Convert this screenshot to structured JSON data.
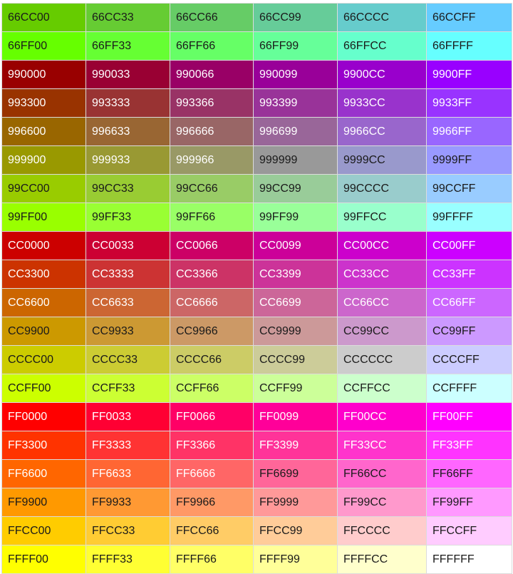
{
  "palette": {
    "rows": [
      [
        "66CC00",
        "66CC33",
        "66CC66",
        "66CC99",
        "66CCCC",
        "66CCFF"
      ],
      [
        "66FF00",
        "66FF33",
        "66FF66",
        "66FF99",
        "66FFCC",
        "66FFFF"
      ],
      [
        "990000",
        "990033",
        "990066",
        "990099",
        "9900CC",
        "9900FF"
      ],
      [
        "993300",
        "993333",
        "993366",
        "993399",
        "9933CC",
        "9933FF"
      ],
      [
        "996600",
        "996633",
        "996666",
        "996699",
        "9966CC",
        "9966FF"
      ],
      [
        "999900",
        "999933",
        "999966",
        "999999",
        "9999CC",
        "9999FF"
      ],
      [
        "99CC00",
        "99CC33",
        "99CC66",
        "99CC99",
        "99CCCC",
        "99CCFF"
      ],
      [
        "99FF00",
        "99FF33",
        "99FF66",
        "99FF99",
        "99FFCC",
        "99FFFF"
      ],
      [
        "CC0000",
        "CC0033",
        "CC0066",
        "CC0099",
        "CC00CC",
        "CC00FF"
      ],
      [
        "CC3300",
        "CC3333",
        "CC3366",
        "CC3399",
        "CC33CC",
        "CC33FF"
      ],
      [
        "CC6600",
        "CC6633",
        "CC6666",
        "CC6699",
        "CC66CC",
        "CC66FF"
      ],
      [
        "CC9900",
        "CC9933",
        "CC9966",
        "CC9999",
        "CC99CC",
        "CC99FF"
      ],
      [
        "CCCC00",
        "CCCC33",
        "CCCC66",
        "CCCC99",
        "CCCCCC",
        "CCCCFF"
      ],
      [
        "CCFF00",
        "CCFF33",
        "CCFF66",
        "CCFF99",
        "CCFFCC",
        "CCFFFF"
      ],
      [
        "FF0000",
        "FF0033",
        "FF0066",
        "FF0099",
        "FF00CC",
        "FF00FF"
      ],
      [
        "FF3300",
        "FF3333",
        "FF3366",
        "FF3399",
        "FF33CC",
        "FF33FF"
      ],
      [
        "FF6600",
        "FF6633",
        "FF6666",
        "FF6699",
        "FF66CC",
        "FF66FF"
      ],
      [
        "FF9900",
        "FF9933",
        "FF9966",
        "FF9999",
        "FF99CC",
        "FF99FF"
      ],
      [
        "FFCC00",
        "FFCC33",
        "FFCC66",
        "FFCC99",
        "FFCCCC",
        "FFCCFF"
      ],
      [
        "FFFF00",
        "FFFF33",
        "FFFF66",
        "FFFF99",
        "FFFFCC",
        "FFFFFF"
      ]
    ]
  }
}
